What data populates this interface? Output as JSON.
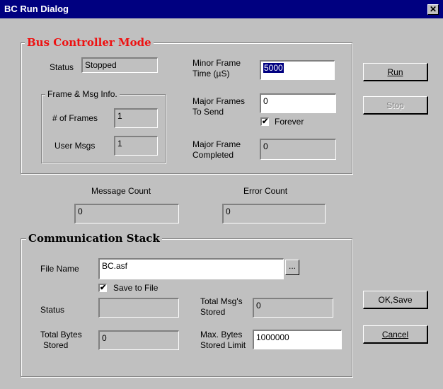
{
  "window": {
    "title": "BC Run Dialog",
    "close_glyph": "✕"
  },
  "bus_controller": {
    "heading": "Bus Controller Mode",
    "status_label": "Status",
    "status_value": "Stopped",
    "frame_group_title": "Frame & Msg Info.",
    "frames_label": "# of Frames",
    "frames_value": "1",
    "user_msgs_label": "User Msgs",
    "user_msgs_value": "1",
    "minor_frame_label_1": "Minor Frame",
    "minor_frame_label_2": "Time (µS)",
    "minor_frame_value": "5000",
    "major_frames_label_1": "Major Frames",
    "major_frames_label_2": "To Send",
    "major_frames_value": "0",
    "forever_label": "Forever",
    "forever_checked": true,
    "major_completed_label_1": "Major Frame",
    "major_completed_label_2": "Completed",
    "major_completed_value": "0"
  },
  "counts": {
    "message_count_label": "Message Count",
    "message_count_value": "0",
    "error_count_label": "Error Count",
    "error_count_value": "0"
  },
  "comm_stack": {
    "heading": "Communication Stack",
    "file_name_label": "File Name",
    "file_name_value": "BC.asf",
    "browse_label": "...",
    "save_to_file_label": "Save to File",
    "save_to_file_checked": true,
    "status_label": "Status",
    "status_value": "",
    "total_msgs_label_1": "Total Msg's",
    "total_msgs_label_2": "Stored",
    "total_msgs_value": "0",
    "total_bytes_label_1": "Total Bytes",
    "total_bytes_label_2": "Stored",
    "total_bytes_value": "0",
    "max_bytes_label_1": "Max. Bytes",
    "max_bytes_label_2": "Stored Limit",
    "max_bytes_value": "1000000"
  },
  "buttons": {
    "run": "Run",
    "stop": "Stop",
    "ok_save": "OK,Save",
    "cancel": "Cancel"
  },
  "checkmark": "✔"
}
